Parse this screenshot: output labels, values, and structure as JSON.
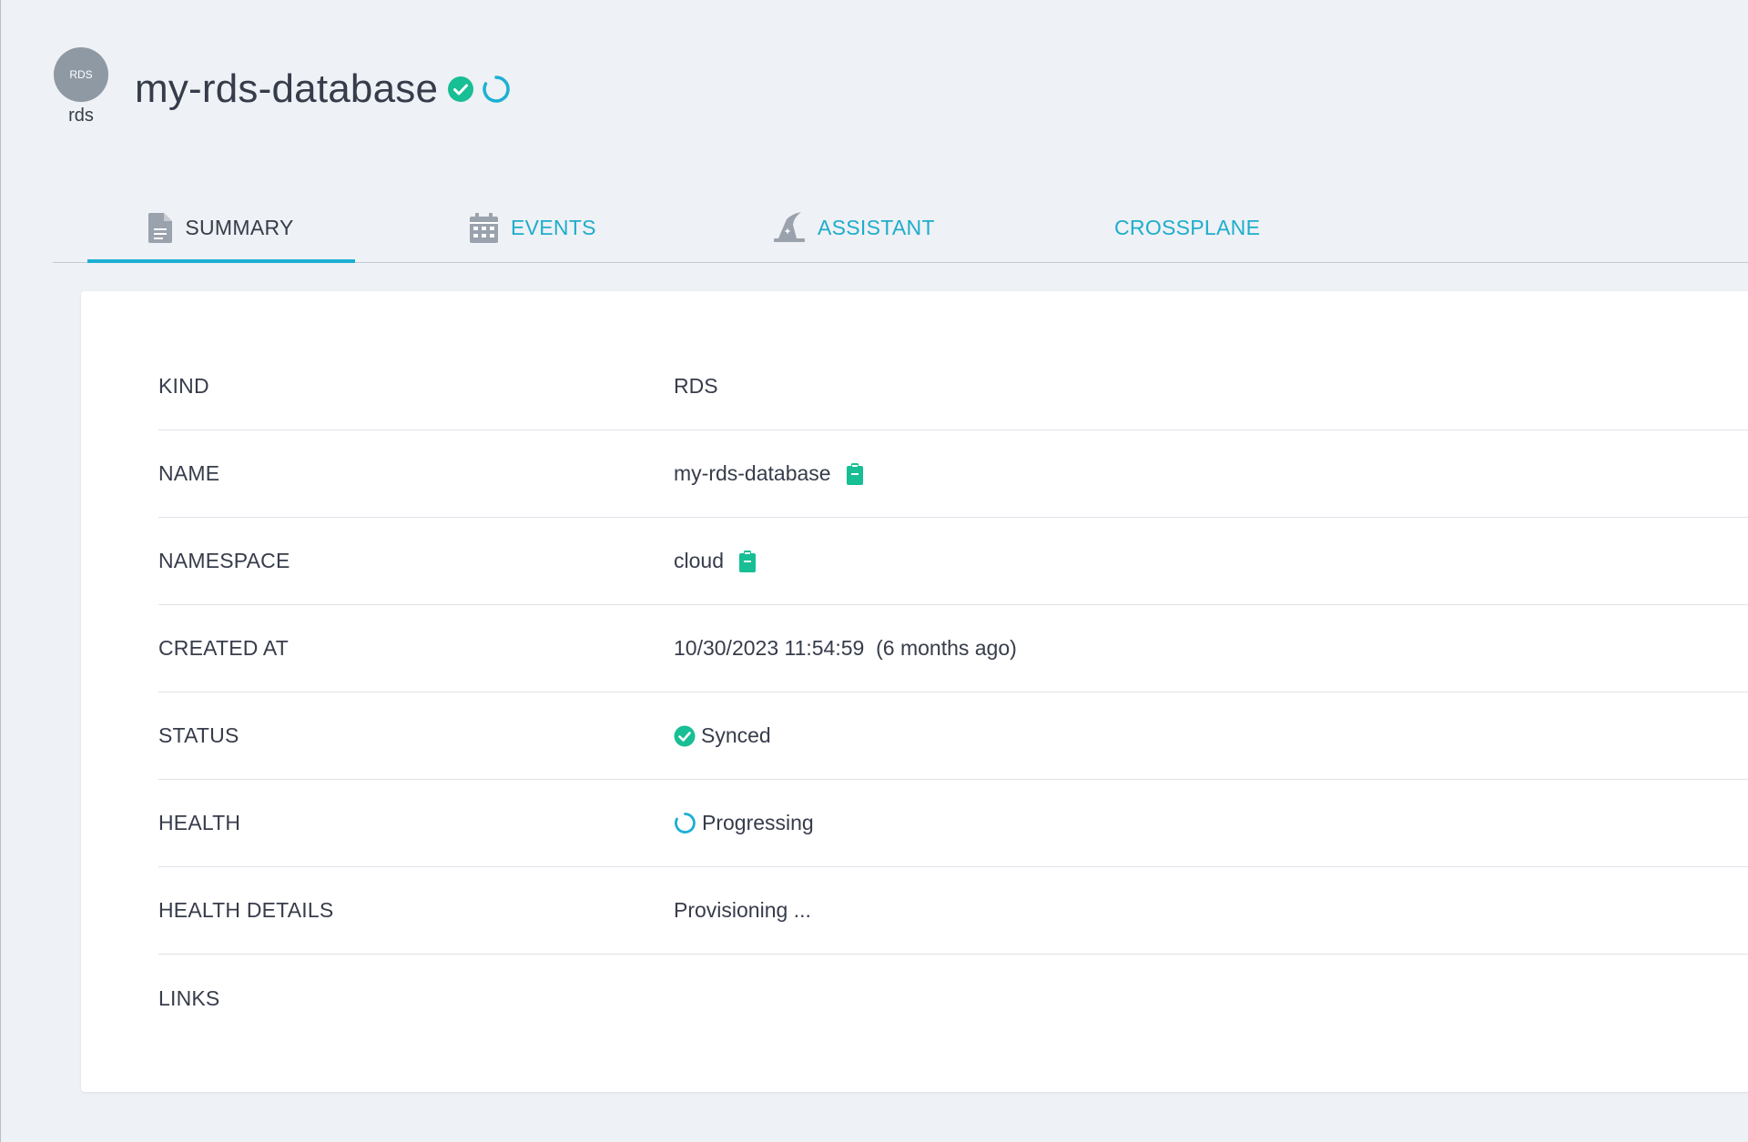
{
  "header": {
    "resource_icon_text": "RDS",
    "resource_kind_label": "rds",
    "title": "my-rds-database",
    "sync_status_icon": "check-circle-icon",
    "health_status_icon": "progressing-circle-icon"
  },
  "tabs": [
    {
      "label": "SUMMARY",
      "icon": "document-icon",
      "active": true
    },
    {
      "label": "EVENTS",
      "icon": "calendar-icon",
      "active": false
    },
    {
      "label": "ASSISTANT",
      "icon": "wizard-hat-icon",
      "active": false
    },
    {
      "label": "CROSSPLANE",
      "icon": "",
      "active": false
    }
  ],
  "summary": {
    "rows": [
      {
        "key": "KIND",
        "value": "RDS"
      },
      {
        "key": "NAME",
        "value": "my-rds-database",
        "copy_icon": "clipboard-icon"
      },
      {
        "key": "NAMESPACE",
        "value": "cloud",
        "copy_icon": "clipboard-icon"
      },
      {
        "key": "CREATED AT",
        "value": "10/30/2023 11:54:59  (6 months ago)"
      },
      {
        "key": "STATUS",
        "value": "Synced",
        "status_icon": "check-circle-icon"
      },
      {
        "key": "HEALTH",
        "value": "Progressing",
        "status_icon": "progressing-circle-icon"
      },
      {
        "key": "HEALTH DETAILS",
        "value": "Provisioning ..."
      },
      {
        "key": "LINKS",
        "value": ""
      }
    ]
  },
  "colors": {
    "accent": "#1eadcc",
    "synced_green": "#18be94",
    "text": "#363c4a",
    "background": "#eef1f5"
  }
}
